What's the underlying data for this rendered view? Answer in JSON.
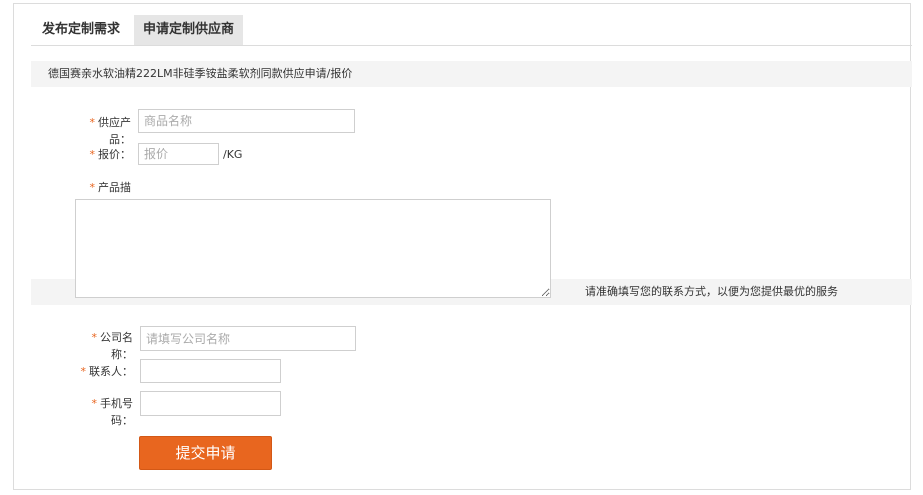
{
  "tabs": [
    {
      "label": "发布定制需求"
    },
    {
      "label": "申请定制供应商"
    }
  ],
  "product_title": "德国赛亲水软油精222LM非硅季铵盐柔软剂同款供应申请/报价",
  "form": {
    "required_mark": "*",
    "supply_product": {
      "label_line1": "供应产",
      "label_line2": "品：",
      "placeholder": "商品名称"
    },
    "price": {
      "label": "报价：",
      "placeholder": "报价",
      "unit": "/KG"
    },
    "description": {
      "label": "产品描"
    },
    "contact_hint": "请准确填写您的联系方式，以便为您提供最优的服务",
    "company": {
      "label_line1": "公司名",
      "label_line2": "称：",
      "placeholder": "请填写公司名称"
    },
    "contact_person": {
      "label": "联系人：",
      "placeholder": ""
    },
    "phone": {
      "label_line1": "手机号",
      "label_line2": "码：",
      "placeholder": ""
    },
    "submit_label": "提交申请"
  },
  "colors": {
    "accent": "#e8661f",
    "required": "#e8641e"
  }
}
